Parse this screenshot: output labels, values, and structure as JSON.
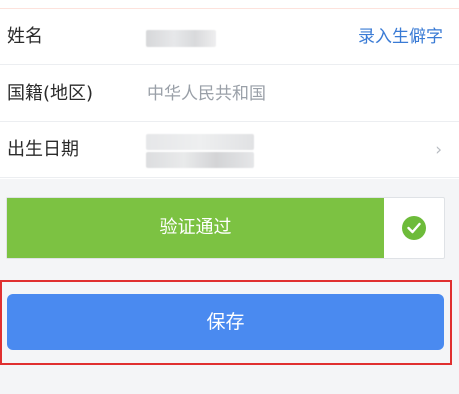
{
  "form": {
    "name_label": "姓名",
    "rare_char_link": "录入生僻字",
    "nationality_label": "国籍(地区)",
    "nationality_value": "中华人民共和国",
    "birthdate_label": "出生日期",
    "chevron": "›"
  },
  "verify": {
    "status_text": "验证通过",
    "check_icon": "check-circle-icon",
    "bar_color": "#7cc242"
  },
  "actions": {
    "save_label": "保存",
    "save_color": "#4a8af0",
    "highlight_color": "#e03030"
  }
}
